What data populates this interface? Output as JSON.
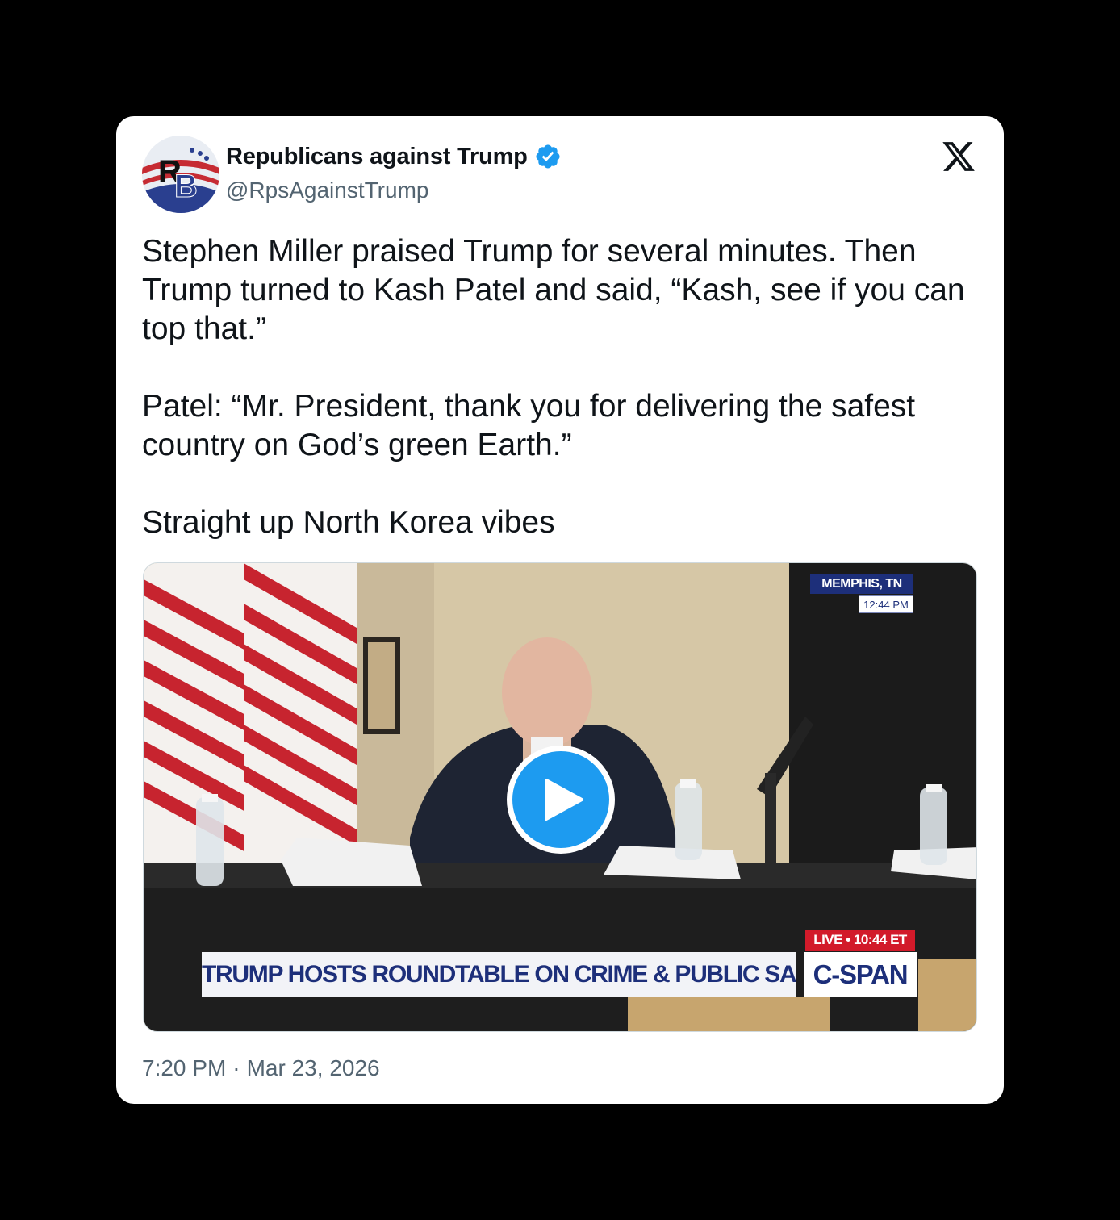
{
  "author": {
    "name": "Republicans against Trump",
    "handle": "@RpsAgainstTrump",
    "avatar_letters": "RB",
    "verified": true,
    "verified_color": "#1d9bf0"
  },
  "platform_icon": "x-logo-icon",
  "tweet": {
    "paragraphs": [
      "Stephen Miller praised Trump for several minutes. Then\nTrump turned to Kash Patel and said, “Kash, see if you can\ntop that.”",
      "Patel: “Mr. President, thank you for delivering the safest\ncountry on God’s green Earth.”",
      "Straight up North Korea vibes"
    ]
  },
  "media": {
    "type": "video",
    "play_icon": "play-icon",
    "location_badge": "MEMPHIS, TN",
    "location_time": "12:44 PM",
    "live_badge": "LIVE • 10:44 ET",
    "lower_third": "TRUMP HOSTS ROUNDTABLE ON CRIME & PUBLIC SAFETY",
    "network": "C-SPAN"
  },
  "footer": {
    "time": "7:20 PM",
    "separator": "·",
    "date": "Mar 23, 2026"
  },
  "colors": {
    "background": "#000000",
    "card": "#ffffff",
    "text": "#0f1419",
    "muted": "#536471",
    "accent": "#1d9bf0"
  }
}
